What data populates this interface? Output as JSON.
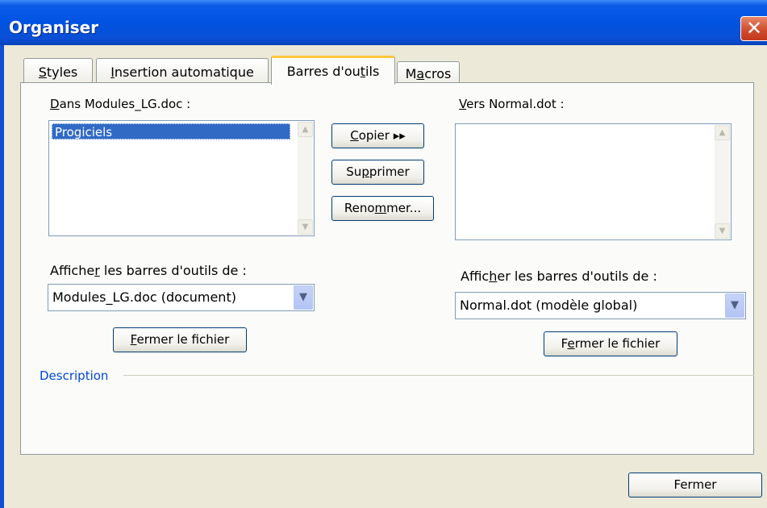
{
  "window": {
    "title": "Organiser",
    "close_glyph": "✕"
  },
  "tabs": [
    {
      "label": "Styles",
      "accel": "S",
      "rest": "tyles"
    },
    {
      "label": "Insertion automatique",
      "accel": "I",
      "rest": "nsertion automatique"
    },
    {
      "label": "Barres d'outils",
      "pre": "Barres d'ou",
      "accel": "t",
      "rest": "ils",
      "active": true
    },
    {
      "label": "Macros",
      "pre": "M",
      "accel": "a",
      "rest": "cros"
    }
  ],
  "left": {
    "source_label_pre": "",
    "source_accel": "D",
    "source_label_rest": "ans Modules_LG.doc :",
    "list_items": [
      "Progiciels"
    ],
    "show_label_pre": "Affiche",
    "show_accel": "r",
    "show_label_rest": " les barres d'outils de :",
    "combo_value": "Modules_LG.doc (document)",
    "close_file_accel": "F",
    "close_file_rest": "ermer le fichier"
  },
  "right": {
    "dest_accel": "V",
    "dest_label_rest": "ers Normal.dot :",
    "list_items": [],
    "show_label_pre": "Affic",
    "show_accel": "h",
    "show_label_rest": "er les barres d'outils de :",
    "combo_value": "Normal.dot (modèle global)",
    "close_file_pre": "F",
    "close_file_accel": "e",
    "close_file_rest": "rmer le fichier"
  },
  "actions": {
    "copy_accel": "C",
    "copy_rest": "opier ▸▸",
    "delete_pre": "Su",
    "delete_accel": "p",
    "delete_rest": "primer",
    "rename_pre": "Reno",
    "rename_accel": "m",
    "rename_rest": "mer..."
  },
  "description": {
    "label": "Description"
  },
  "footer": {
    "close_label": "Fermer"
  },
  "icons": {
    "scroll_up": "▲",
    "scroll_down": "▼",
    "combo_arrow": "▼"
  }
}
